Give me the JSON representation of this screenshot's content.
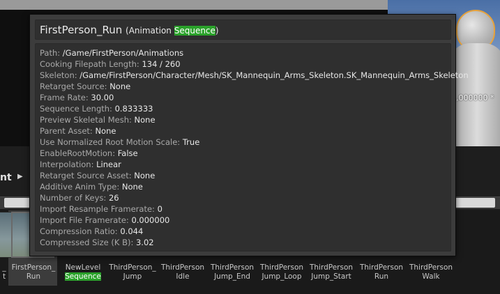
{
  "viewport": {
    "coord_readout": ",000000 *"
  },
  "content_browser": {
    "header_label": "nt",
    "assets": [
      {
        "line1": "_",
        "line2": "t",
        "selected": false
      },
      {
        "line1": "FirstPerson_",
        "line2": "Run",
        "selected": true
      },
      {
        "line1": "NewLevel",
        "line2": "Sequence",
        "selected": false
      },
      {
        "line1": "ThirdPerson_",
        "line2": "Jump",
        "selected": false
      },
      {
        "line1": "ThirdPerson",
        "line2": "Idle",
        "selected": false
      },
      {
        "line1": "ThirdPerson",
        "line2": "Jump_End",
        "selected": false
      },
      {
        "line1": "ThirdPerson",
        "line2": "Jump_Loop",
        "selected": false
      },
      {
        "line1": "ThirdPerson",
        "line2": "Jump_Start",
        "selected": false
      },
      {
        "line1": "ThirdPerson",
        "line2": "Run",
        "selected": false
      },
      {
        "line1": "ThirdPerson",
        "line2": "Walk",
        "selected": false
      }
    ]
  },
  "tooltip": {
    "title": "FirstPerson_Run",
    "type_prefix": "(Animation ",
    "type_highlight": "Sequence",
    "type_suffix": ")",
    "properties": [
      {
        "key": "Path:",
        "value": "/Game/FirstPerson/Animations"
      },
      {
        "key": "Cooking Filepath Length:",
        "value": "134 / 260"
      },
      {
        "key": "Skeleton:",
        "value": "/Game/FirstPerson/Character/Mesh/SK_Mannequin_Arms_Skeleton.SK_Mannequin_Arms_Skeleton"
      },
      {
        "key": "Retarget Source:",
        "value": "None"
      },
      {
        "key": "Frame Rate:",
        "value": "30.00"
      },
      {
        "key": "Sequence Length:",
        "value": "0.833333"
      },
      {
        "key": "Preview Skeletal Mesh:",
        "value": "None"
      },
      {
        "key": "Parent Asset:",
        "value": "None"
      },
      {
        "key": "Use Normalized Root Motion Scale:",
        "value": "True"
      },
      {
        "key": "EnableRootMotion:",
        "value": "False"
      },
      {
        "key": "Interpolation:",
        "value": "Linear"
      },
      {
        "key": "Retarget Source Asset:",
        "value": "None"
      },
      {
        "key": "Additive Anim Type:",
        "value": "None"
      },
      {
        "key": "Number of Keys:",
        "value": "26"
      },
      {
        "key": "Import Resample Framerate:",
        "value": "0"
      },
      {
        "key": "Import File Framerate:",
        "value": "0.000000"
      },
      {
        "key": "Compression Ratio:",
        "value": "0.044"
      },
      {
        "key": "Compressed Size (K B):",
        "value": "3.02"
      }
    ]
  },
  "colors": {
    "highlight": "#2aa12a",
    "tooltip_bg": "#3c3c3c",
    "panel_bg": "#2f2f2f"
  }
}
